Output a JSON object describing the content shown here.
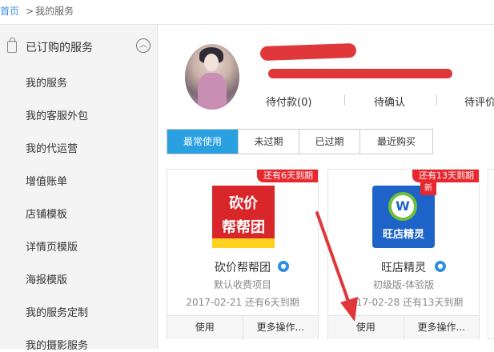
{
  "breadcrumb": {
    "home": "首页",
    "separator": ">",
    "current": "我的服务"
  },
  "sidebar": {
    "header": "已订购的服务",
    "toggle_icon": "chevron-up-icon",
    "items": [
      {
        "label": "我的服务"
      },
      {
        "label": "我的客服外包"
      },
      {
        "label": "我的代运营"
      },
      {
        "label": "增值账单"
      },
      {
        "label": "店铺模板"
      },
      {
        "label": "详情页模版"
      },
      {
        "label": "海报模版"
      },
      {
        "label": "我的服务定制"
      },
      {
        "label": "我的摄影服务"
      }
    ]
  },
  "profile": {
    "order_tabs": [
      {
        "label": "待付款(0)"
      },
      {
        "label": "待确认"
      },
      {
        "label": "待评价"
      }
    ]
  },
  "filter_tabs": [
    {
      "label": "最常使用",
      "active": true
    },
    {
      "label": "未过期",
      "active": false
    },
    {
      "label": "已过期",
      "active": false
    },
    {
      "label": "最近购买",
      "active": false
    }
  ],
  "cards": [
    {
      "badge": "还有6天到期",
      "logo_text": [
        "砍价",
        "帮帮团"
      ],
      "name": "砍价帮帮团",
      "subtitle": "默认收费项目",
      "date": "2017-02-21 还有6天到期",
      "actions": [
        "使用",
        "更多操作..."
      ]
    },
    {
      "badge": "还有13天到期",
      "logo_text": [
        "旺店精灵"
      ],
      "logo_badge": "新",
      "name": "旺店精灵",
      "subtitle": "初级版-体验版",
      "date": "2017-02-28 还有13天到期",
      "actions": [
        "使用",
        "更多操作..."
      ]
    }
  ],
  "colors": {
    "accent": "#2aa0e0",
    "badge": "#e8282f",
    "annotation": "#e0383a"
  }
}
